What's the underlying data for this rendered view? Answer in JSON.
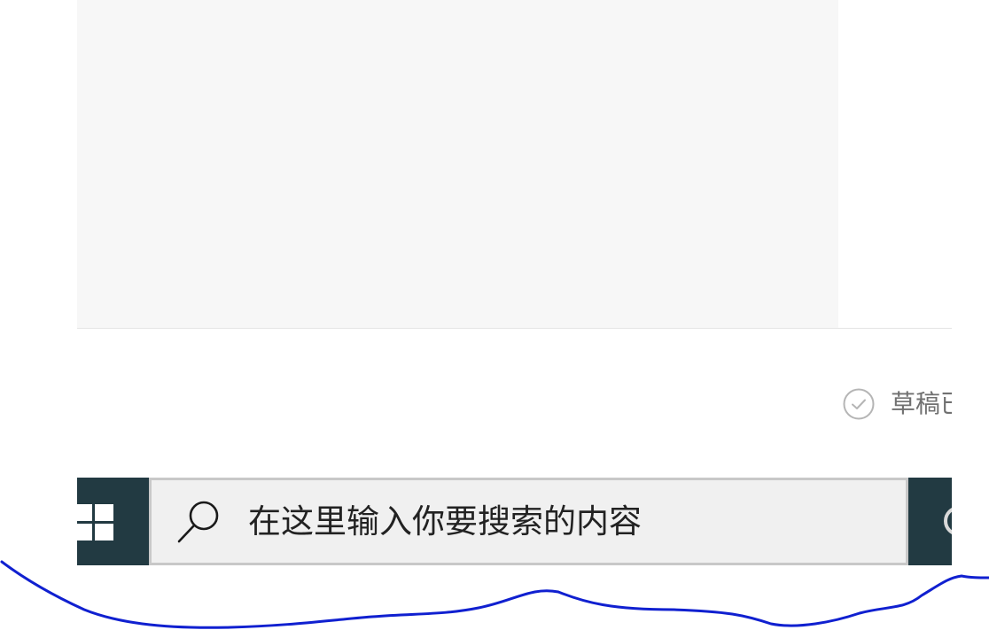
{
  "draft": {
    "status_text": "草稿已保存",
    "icon": "check-circle-icon"
  },
  "taskbar": {
    "start_icon": "windows-logo-icon",
    "search": {
      "icon": "search-icon",
      "placeholder": "在这里输入你要搜索的内容"
    },
    "tray_icon": "cortana-icon"
  },
  "annotation": {
    "stroke_color": "#1020d0"
  },
  "colors": {
    "taskbar_bg": "#223a42",
    "panel_bg": "#f7f7f7"
  }
}
